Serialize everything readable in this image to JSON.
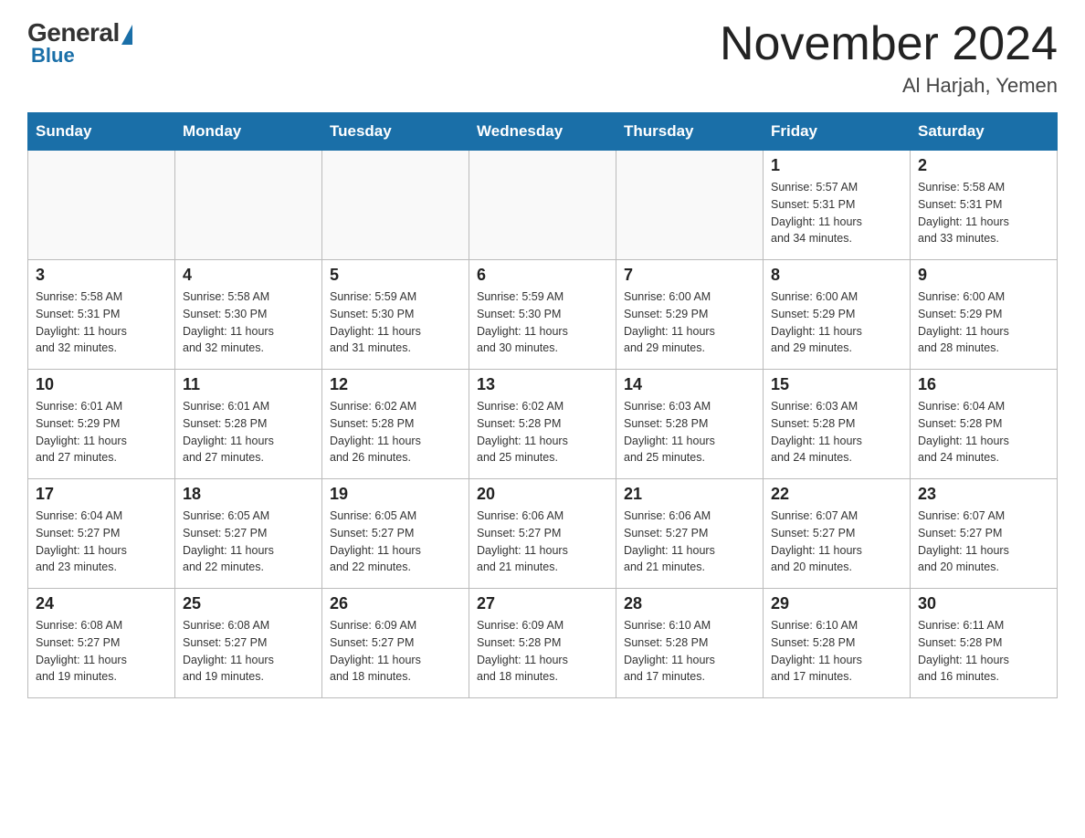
{
  "logo": {
    "general": "General",
    "blue": "Blue"
  },
  "title": "November 2024",
  "subtitle": "Al Harjah, Yemen",
  "weekdays": [
    "Sunday",
    "Monday",
    "Tuesday",
    "Wednesday",
    "Thursday",
    "Friday",
    "Saturday"
  ],
  "weeks": [
    [
      {
        "day": "",
        "info": ""
      },
      {
        "day": "",
        "info": ""
      },
      {
        "day": "",
        "info": ""
      },
      {
        "day": "",
        "info": ""
      },
      {
        "day": "",
        "info": ""
      },
      {
        "day": "1",
        "info": "Sunrise: 5:57 AM\nSunset: 5:31 PM\nDaylight: 11 hours\nand 34 minutes."
      },
      {
        "day": "2",
        "info": "Sunrise: 5:58 AM\nSunset: 5:31 PM\nDaylight: 11 hours\nand 33 minutes."
      }
    ],
    [
      {
        "day": "3",
        "info": "Sunrise: 5:58 AM\nSunset: 5:31 PM\nDaylight: 11 hours\nand 32 minutes."
      },
      {
        "day": "4",
        "info": "Sunrise: 5:58 AM\nSunset: 5:30 PM\nDaylight: 11 hours\nand 32 minutes."
      },
      {
        "day": "5",
        "info": "Sunrise: 5:59 AM\nSunset: 5:30 PM\nDaylight: 11 hours\nand 31 minutes."
      },
      {
        "day": "6",
        "info": "Sunrise: 5:59 AM\nSunset: 5:30 PM\nDaylight: 11 hours\nand 30 minutes."
      },
      {
        "day": "7",
        "info": "Sunrise: 6:00 AM\nSunset: 5:29 PM\nDaylight: 11 hours\nand 29 minutes."
      },
      {
        "day": "8",
        "info": "Sunrise: 6:00 AM\nSunset: 5:29 PM\nDaylight: 11 hours\nand 29 minutes."
      },
      {
        "day": "9",
        "info": "Sunrise: 6:00 AM\nSunset: 5:29 PM\nDaylight: 11 hours\nand 28 minutes."
      }
    ],
    [
      {
        "day": "10",
        "info": "Sunrise: 6:01 AM\nSunset: 5:29 PM\nDaylight: 11 hours\nand 27 minutes."
      },
      {
        "day": "11",
        "info": "Sunrise: 6:01 AM\nSunset: 5:28 PM\nDaylight: 11 hours\nand 27 minutes."
      },
      {
        "day": "12",
        "info": "Sunrise: 6:02 AM\nSunset: 5:28 PM\nDaylight: 11 hours\nand 26 minutes."
      },
      {
        "day": "13",
        "info": "Sunrise: 6:02 AM\nSunset: 5:28 PM\nDaylight: 11 hours\nand 25 minutes."
      },
      {
        "day": "14",
        "info": "Sunrise: 6:03 AM\nSunset: 5:28 PM\nDaylight: 11 hours\nand 25 minutes."
      },
      {
        "day": "15",
        "info": "Sunrise: 6:03 AM\nSunset: 5:28 PM\nDaylight: 11 hours\nand 24 minutes."
      },
      {
        "day": "16",
        "info": "Sunrise: 6:04 AM\nSunset: 5:28 PM\nDaylight: 11 hours\nand 24 minutes."
      }
    ],
    [
      {
        "day": "17",
        "info": "Sunrise: 6:04 AM\nSunset: 5:27 PM\nDaylight: 11 hours\nand 23 minutes."
      },
      {
        "day": "18",
        "info": "Sunrise: 6:05 AM\nSunset: 5:27 PM\nDaylight: 11 hours\nand 22 minutes."
      },
      {
        "day": "19",
        "info": "Sunrise: 6:05 AM\nSunset: 5:27 PM\nDaylight: 11 hours\nand 22 minutes."
      },
      {
        "day": "20",
        "info": "Sunrise: 6:06 AM\nSunset: 5:27 PM\nDaylight: 11 hours\nand 21 minutes."
      },
      {
        "day": "21",
        "info": "Sunrise: 6:06 AM\nSunset: 5:27 PM\nDaylight: 11 hours\nand 21 minutes."
      },
      {
        "day": "22",
        "info": "Sunrise: 6:07 AM\nSunset: 5:27 PM\nDaylight: 11 hours\nand 20 minutes."
      },
      {
        "day": "23",
        "info": "Sunrise: 6:07 AM\nSunset: 5:27 PM\nDaylight: 11 hours\nand 20 minutes."
      }
    ],
    [
      {
        "day": "24",
        "info": "Sunrise: 6:08 AM\nSunset: 5:27 PM\nDaylight: 11 hours\nand 19 minutes."
      },
      {
        "day": "25",
        "info": "Sunrise: 6:08 AM\nSunset: 5:27 PM\nDaylight: 11 hours\nand 19 minutes."
      },
      {
        "day": "26",
        "info": "Sunrise: 6:09 AM\nSunset: 5:27 PM\nDaylight: 11 hours\nand 18 minutes."
      },
      {
        "day": "27",
        "info": "Sunrise: 6:09 AM\nSunset: 5:28 PM\nDaylight: 11 hours\nand 18 minutes."
      },
      {
        "day": "28",
        "info": "Sunrise: 6:10 AM\nSunset: 5:28 PM\nDaylight: 11 hours\nand 17 minutes."
      },
      {
        "day": "29",
        "info": "Sunrise: 6:10 AM\nSunset: 5:28 PM\nDaylight: 11 hours\nand 17 minutes."
      },
      {
        "day": "30",
        "info": "Sunrise: 6:11 AM\nSunset: 5:28 PM\nDaylight: 11 hours\nand 16 minutes."
      }
    ]
  ]
}
